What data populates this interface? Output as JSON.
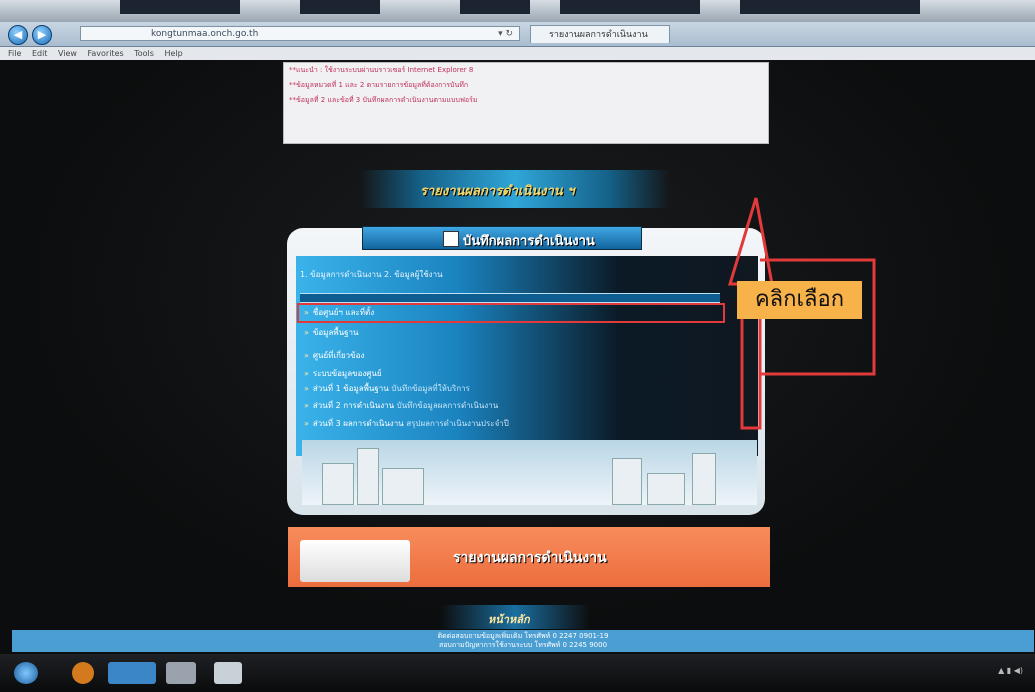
{
  "browser": {
    "url": "kongtunmaa.onch.go.th",
    "tab_title": "รายงานผลการดำเนินงาน",
    "menu": [
      "File",
      "Edit",
      "View",
      "Favorites",
      "Tools",
      "Help"
    ]
  },
  "notice": {
    "lines": [
      "**แนะนำ : ใช้งานระบบผ่านบราวเซอร์ Internet Explorer 8",
      "**ข้อมูลหมวดที่ 1 และ 2 ตามรายการข้อมูลที่ต้องการบันทึก",
      "**ข้อมูลที่ 2 และข้อที่ 3 บันทึกผลการดำเนินงานตามแบบฟอร์ม"
    ]
  },
  "header_banner": "รายงานผลการดำเนินงาน ฯ",
  "tab_banner": "บันทึกผลการดำเนินงาน",
  "breadcrumb": "1. ข้อมูลการดำเนินงาน  2. ข้อมูลผู้ใช้งาน",
  "items": [
    {
      "bullet": "»",
      "text": "ชื่อศูนย์ฯ และที่ตั้ง",
      "desc": ""
    },
    {
      "bullet": "»",
      "text": "ข้อมูลพื้นฐาน",
      "desc": ""
    },
    {
      "bullet": "»",
      "text": "ศูนย์ที่เกี่ยวข้อง",
      "desc": ""
    },
    {
      "bullet": "»",
      "text": "ระบบข้อมูลของศูนย์",
      "desc": ""
    },
    {
      "bullet": "»",
      "text": "ส่วนที่ 1 ข้อมูลพื้นฐาน",
      "desc": "บันทึกข้อมูลที่ให้บริการ"
    },
    {
      "bullet": "»",
      "text": "ส่วนที่ 2 การดำเนินงาน",
      "desc": "บันทึกข้อมูลผลการดำเนินงาน"
    },
    {
      "bullet": "»",
      "text": "ส่วนที่ 3 ผลการดำเนินงาน",
      "desc": "สรุปผลการดำเนินงานประจำปี"
    }
  ],
  "callout_label": "คลิกเลือก",
  "report_banner": "รายงานผลการดำเนินงาน",
  "back_button": "หน้าหลัก",
  "footer": {
    "line1": "ติดต่อสอบถามข้อมูลเพิ่มเติม โทรศัพท์ 0 2247 0901-19",
    "line2": "สอบถามปัญหาการใช้งานระบบ โทรศัพท์ 0 2245 9000"
  },
  "colors": {
    "background": "#0b0d0f",
    "accent_blue": "#2fa6d8",
    "highlight_red": "#e23a3a",
    "callout_orange": "#f7b24a",
    "report_orange": "#ec6d3d"
  }
}
